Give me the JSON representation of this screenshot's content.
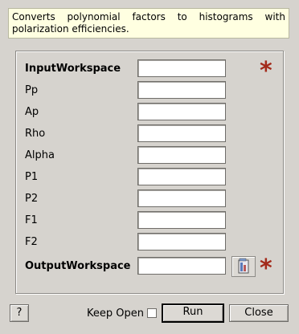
{
  "description": "Converts polynomial factors to histograms with polarization efficiencies.",
  "fields": [
    {
      "label": "InputWorkspace",
      "bold": true,
      "value": "",
      "required": true
    },
    {
      "label": "Pp",
      "bold": false,
      "value": ""
    },
    {
      "label": "Ap",
      "bold": false,
      "value": ""
    },
    {
      "label": "Rho",
      "bold": false,
      "value": ""
    },
    {
      "label": "Alpha",
      "bold": false,
      "value": ""
    },
    {
      "label": "P1",
      "bold": false,
      "value": ""
    },
    {
      "label": "P2",
      "bold": false,
      "value": ""
    },
    {
      "label": "F1",
      "bold": false,
      "value": ""
    },
    {
      "label": "F2",
      "bold": false,
      "value": ""
    },
    {
      "label": "OutputWorkspace",
      "bold": true,
      "value": "",
      "required": true
    }
  ],
  "required_marker": "*",
  "buttons": {
    "help": "?",
    "keep_open": "Keep Open",
    "run": "Run",
    "close": "Close"
  },
  "keep_open_checked": false,
  "colors": {
    "required": "#a32a1a",
    "description_bg": "#ffffe1"
  }
}
